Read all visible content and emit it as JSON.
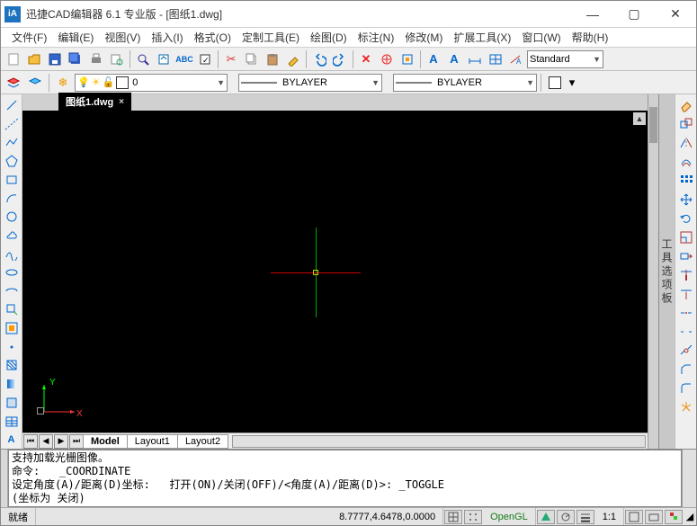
{
  "window": {
    "title": "迅捷CAD编辑器 6.1 专业版  -  [图纸1.dwg]"
  },
  "window_controls": {
    "min": "—",
    "max": "▢",
    "close": "✕"
  },
  "menu": [
    "文件(F)",
    "编辑(E)",
    "视图(V)",
    "插入(I)",
    "格式(O)",
    "定制工具(E)",
    "绘图(D)",
    "标注(N)",
    "修改(M)",
    "扩展工具(X)",
    "窗口(W)",
    "帮助(H)"
  ],
  "toolbar1": {
    "style_text": "Standard"
  },
  "toolbar2": {
    "layer_dropdown": "0",
    "linetype_text": "BYLAYER",
    "lineweight_text": "BYLAYER"
  },
  "file_tab": {
    "name": "图纸1.dwg",
    "close": "×"
  },
  "ucs": {
    "y": "Y",
    "x": "X"
  },
  "layout_tabs": [
    "Model",
    "Layout1",
    "Layout2"
  ],
  "panel_label": "工具选项板",
  "command_lines": "支持加载光栅图像。\n命令:   _COORDINATE\n设定角度(A)/距离(D)坐标:   打开(ON)/关闭(OFF)/<角度(A)/距离(D)>: _TOGGLE\n(坐标为 关闭)\n命令: ",
  "status": {
    "ready": "就绪",
    "coords": "8.7777,4.6478,0.0000",
    "opengl": "OpenGL",
    "ratio": "1:1"
  }
}
